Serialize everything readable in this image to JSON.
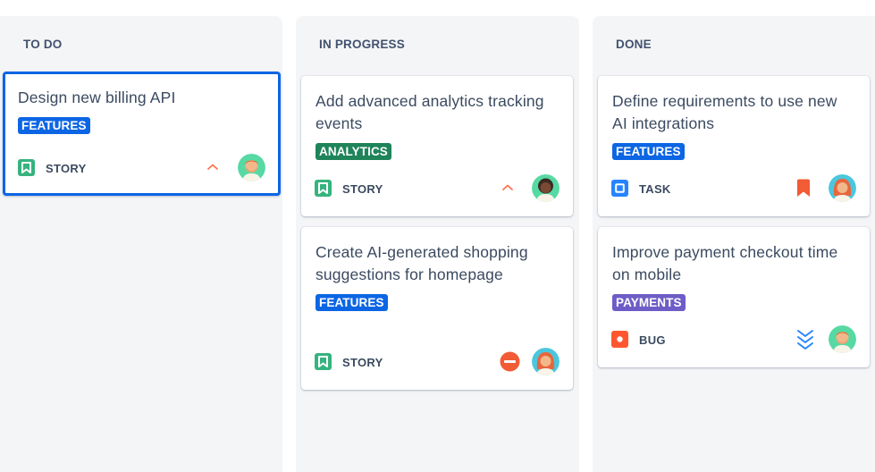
{
  "columns": [
    {
      "title": "TO DO",
      "cards": [
        {
          "title": "Design new billing API",
          "label": "FEATURES",
          "type": "STORY",
          "type_icon": "story-bookmark-icon",
          "priority_icon": "priority-medium-chevron-up-icon",
          "avatar_icon": "avatar-bearded-man-icon",
          "selected": true
        }
      ]
    },
    {
      "title": "IN PROGRESS",
      "cards": [
        {
          "title": "Add advanced analytics tracking events",
          "label": "ANALYTICS",
          "type": "STORY",
          "type_icon": "story-bookmark-icon",
          "priority_icon": "priority-medium-chevron-up-icon",
          "avatar_icon": "avatar-dark-hair-icon"
        },
        {
          "title": "Create AI-generated shopping suggestions for homepage",
          "label": "FEATURES",
          "type": "STORY",
          "type_icon": "story-bookmark-icon",
          "priority_icon": "blocker-icon",
          "avatar_icon": "avatar-red-hair-woman-icon"
        }
      ]
    },
    {
      "title": "DONE",
      "cards": [
        {
          "title": "Define requirements to use new AI integrations",
          "label": "FEATURES",
          "type": "TASK",
          "type_icon": "task-square-icon",
          "priority_icon": "flag-bookmark-icon",
          "avatar_icon": "avatar-red-hair-woman-icon"
        },
        {
          "title": "Improve payment checkout time on mobile",
          "label": "PAYMENTS",
          "type": "BUG",
          "type_icon": "bug-circle-icon",
          "priority_icon": "priority-lowest-triple-chevron-down-icon",
          "avatar_icon": "avatar-bearded-man-icon"
        }
      ]
    }
  ],
  "colors": {
    "selected_border": "#0c66e4",
    "features_label": "#0c66e4",
    "analytics_label": "#1f845a",
    "payments_label": "#6e5dc6",
    "story": "#36b37e",
    "task": "#2684ff",
    "bug": "#ff5630",
    "priority_medium": "#ff7452",
    "priority_lowest": "#2684ff"
  }
}
